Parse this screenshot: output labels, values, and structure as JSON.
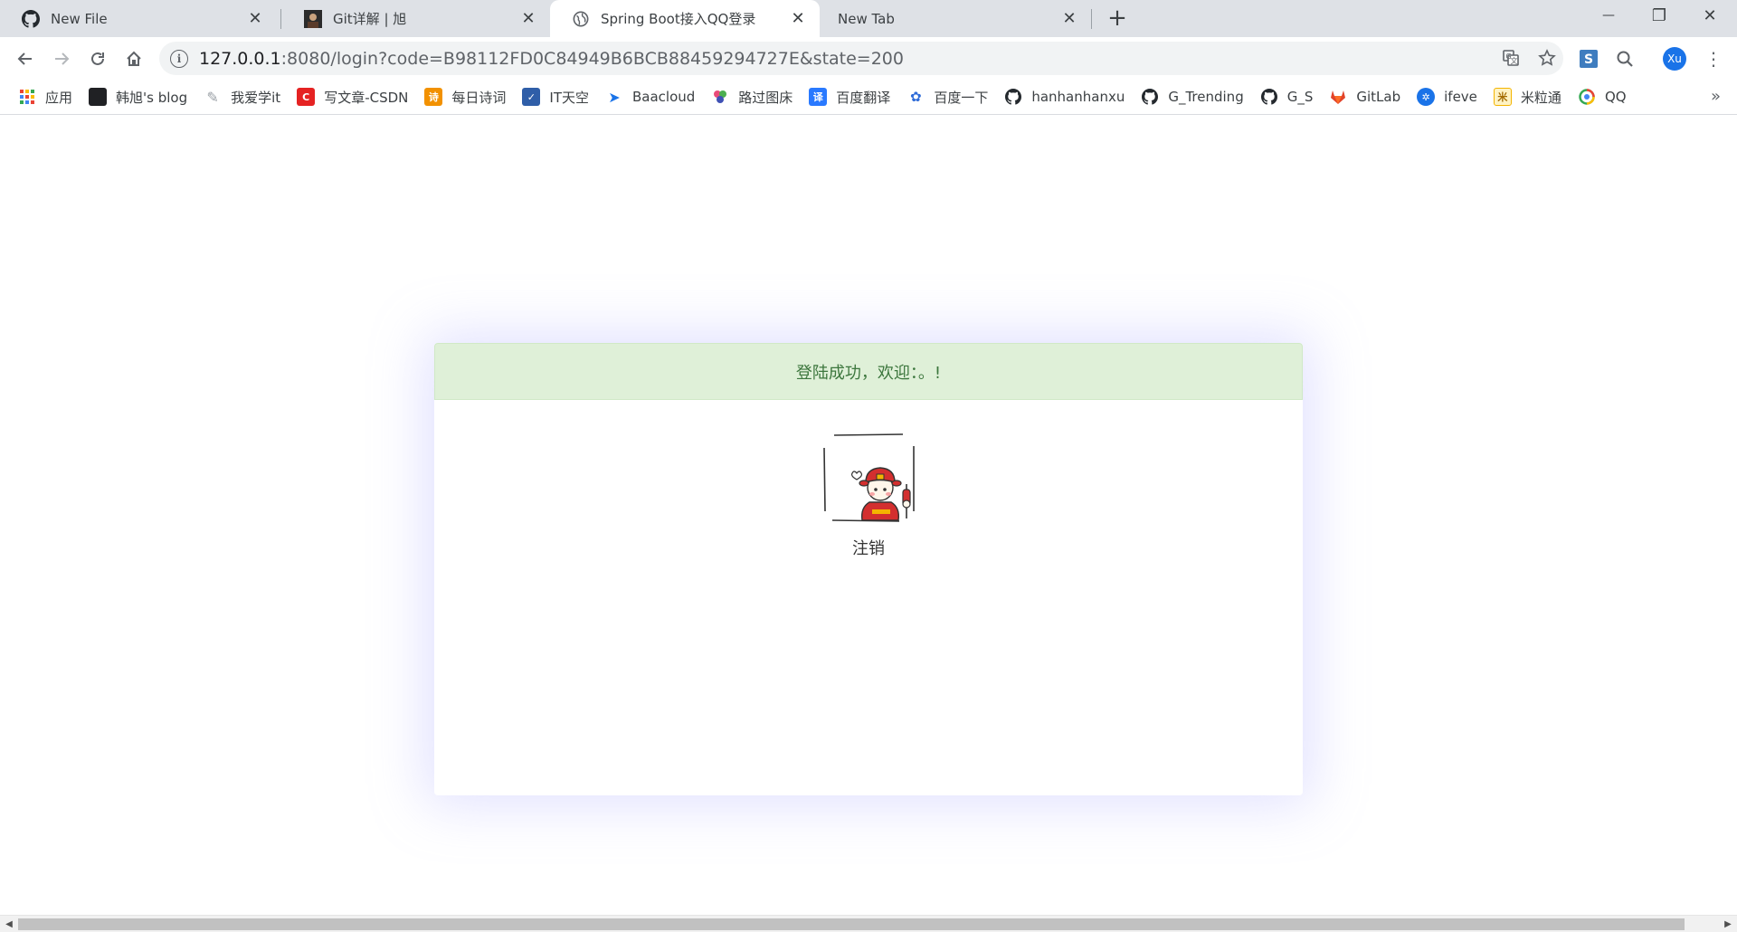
{
  "browser": {
    "tabs": [
      {
        "title": "New File",
        "icon": "github-icon",
        "active": false
      },
      {
        "title": "Git详解 | 旭",
        "icon": "avatar-favicon",
        "active": false
      },
      {
        "title": "Spring Boot接入QQ登录",
        "icon": "globe-icon",
        "active": true
      },
      {
        "title": "New Tab",
        "icon": "none",
        "active": false
      }
    ],
    "new_tab_symbol": "+",
    "window_controls": {
      "minimize": "—",
      "restore": "❐",
      "close": "✕"
    },
    "address": {
      "host": "127.0.0.1",
      "rest": ":8080/login?code=B98112FD0C84949B6BCB88459294727E&state=200"
    },
    "profile_initials": "Xu",
    "bookmarks": [
      {
        "label": "应用",
        "icon": "apps-grid-icon",
        "color": "#ea4335"
      },
      {
        "label": "韩旭's blog",
        "icon": "blog-favicon",
        "color": "#202124"
      },
      {
        "label": "我爱学it",
        "icon": "book-icon",
        "color": "#9aa0a6"
      },
      {
        "label": "写文章-CSDN",
        "icon": "csdn-icon",
        "color": "#e52222"
      },
      {
        "label": "每日诗词",
        "icon": "poem-icon",
        "color": "#f29100"
      },
      {
        "label": "IT天空",
        "icon": "itsky-icon",
        "color": "#2f5ea8"
      },
      {
        "label": "Baacloud",
        "icon": "paper-plane-icon",
        "color": "#1a73e8"
      },
      {
        "label": "路过图床",
        "icon": "flower-icon",
        "color": "#c84c9f"
      },
      {
        "label": "百度翻译",
        "icon": "translate-icon",
        "color": "#2979ff"
      },
      {
        "label": "百度一下",
        "icon": "baidu-paw-icon",
        "color": "#2e6bd8"
      },
      {
        "label": "hanhanhanxu",
        "icon": "github-icon",
        "color": "#202124"
      },
      {
        "label": "G_Trending",
        "icon": "github-icon",
        "color": "#202124"
      },
      {
        "label": "G_S",
        "icon": "github-icon",
        "color": "#202124"
      },
      {
        "label": "GitLab",
        "icon": "gitlab-icon",
        "color": "#e24329"
      },
      {
        "label": "ifeve",
        "icon": "ifeve-icon",
        "color": "#1a73e8"
      },
      {
        "label": "米粒通",
        "icon": "miliitong-icon",
        "color": "#f4b400"
      },
      {
        "label": "QQ",
        "icon": "qq-icon",
        "color": "#34a853"
      }
    ],
    "bookmarks_overflow": "»"
  },
  "page": {
    "alert_text": "登陆成功，欢迎：。!",
    "logout_label": "注销",
    "avatar_alt": "qq-avatar"
  }
}
